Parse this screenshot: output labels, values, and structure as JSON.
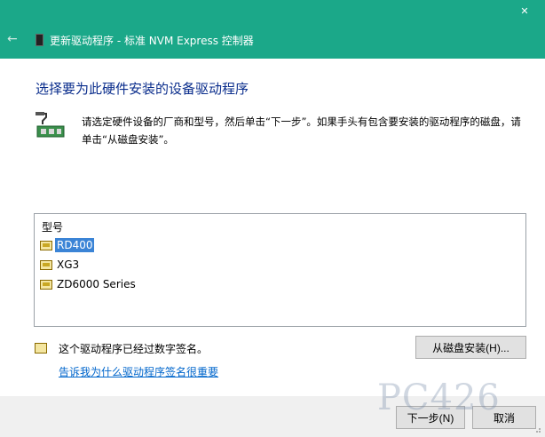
{
  "titlebar": {
    "back": "←",
    "title": "更新驱动程序 - 标准 NVM Express 控制器",
    "close": "✕"
  },
  "heading": "选择要为此硬件安装的设备驱动程序",
  "instruction": "请选定硬件设备的厂商和型号，然后单击“下一步”。如果手头有包含要安装的驱动程序的磁盘，请单击“从磁盘安装”。",
  "list": {
    "header": "型号",
    "items": [
      {
        "label": "RD400",
        "selected": true
      },
      {
        "label": "XG3",
        "selected": false
      },
      {
        "label": "ZD6000 Series",
        "selected": false
      }
    ]
  },
  "signature": {
    "text": "这个驱动程序已经过数字签名。",
    "link": "告诉我为什么驱动程序签名很重要"
  },
  "buttons": {
    "have_disk": "从磁盘安装(H)...",
    "next": "下一步(N)",
    "cancel": "取消"
  },
  "watermark": "PC426",
  "colors": {
    "titlebar": "#1ba889",
    "heading": "#0a2d8c",
    "selection": "#3b84d6",
    "link": "#0066cc"
  }
}
